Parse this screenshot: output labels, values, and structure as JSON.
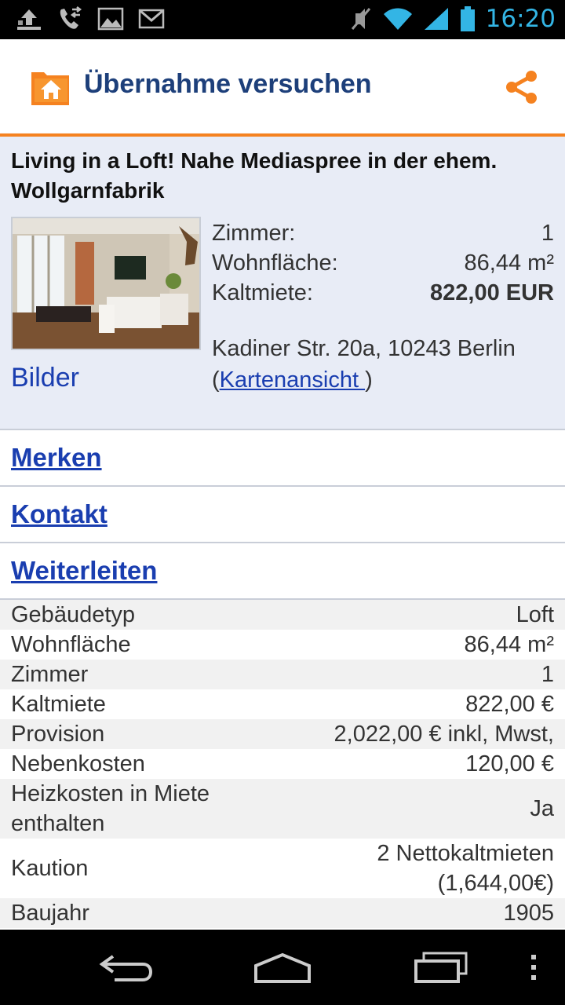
{
  "status_bar": {
    "time": "16:20",
    "icons": [
      "upload-icon",
      "call-forward-icon",
      "image-icon",
      "gmail-icon",
      "mute-icon",
      "wifi-icon",
      "signal-icon",
      "battery-icon"
    ]
  },
  "action_bar": {
    "title": "Übernahme versuchen",
    "app_icon": "home-folder-icon",
    "share_icon": "share-icon"
  },
  "listing": {
    "title": "Living in a Loft! Nahe Mediaspree in der ehem. Wollgarnfabrik",
    "bilder_label": "Bilder",
    "facts": [
      {
        "label": "Zimmer:",
        "value": "1"
      },
      {
        "label": "Wohnfläche:",
        "value": "86,44 m²"
      },
      {
        "label": "Kaltmiete:",
        "value": "822,00 EUR"
      }
    ],
    "address": "Kadiner Str. 20a, 10243 Berlin",
    "map_link_prefix": "(",
    "map_link": "Kartenansicht ",
    "map_link_suffix": ")"
  },
  "actions": {
    "merken": "Merken",
    "kontakt": "Kontakt",
    "weiterleiten": "Weiterleiten"
  },
  "details": [
    {
      "label": "Gebäudetyp",
      "value": "Loft"
    },
    {
      "label": "Wohnfläche",
      "value": "86,44 m²"
    },
    {
      "label": "Zimmer",
      "value": "1"
    },
    {
      "label": "Kaltmiete",
      "value": "822,00 €"
    },
    {
      "label": "Provision",
      "value": "2,022,00 € inkl, Mwst,"
    },
    {
      "label": "Nebenkosten",
      "value": "120,00 €"
    },
    {
      "label": "Heizkosten in Miete enthalten",
      "value": "Ja"
    },
    {
      "label": "Kaution",
      "value": "2 Nettokaltmieten (1,644,00€)"
    },
    {
      "label": "Baujahr",
      "value": "1905"
    }
  ],
  "nav_bar": {
    "icons": [
      "back-icon",
      "home-icon",
      "recent-apps-icon",
      "overflow-menu-icon"
    ]
  },
  "colors": {
    "accent": "#f58220",
    "title_blue": "#1d3f7a",
    "link_blue": "#1a3eb0",
    "summary_bg": "#e8ecf6",
    "status_blue": "#33b5e5"
  }
}
